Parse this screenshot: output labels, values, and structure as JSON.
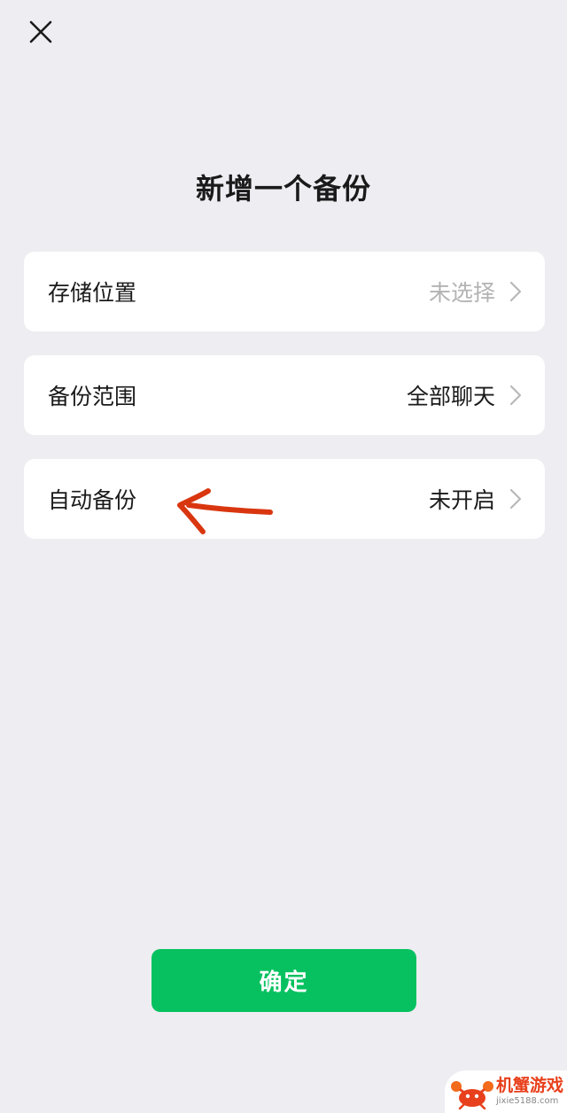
{
  "header": {
    "title": "新增一个备份"
  },
  "settings": {
    "items": [
      {
        "label": "存储位置",
        "value": "未选择"
      },
      {
        "label": "备份范围",
        "value": "全部聊天"
      },
      {
        "label": "自动备份",
        "value": "未开启"
      }
    ]
  },
  "footer": {
    "confirm_label": "确定"
  },
  "watermark": {
    "name": "机蟹游戏",
    "url": "jixie5188.com"
  },
  "colors": {
    "background": "#eeedf2",
    "card": "#ffffff",
    "primary_green": "#07c160",
    "muted_text": "#b3b3b3",
    "annotation_arrow": "#d9360f"
  },
  "icons": {
    "close": "close-icon",
    "chevron": "chevron-right-icon",
    "annotation": "red-arrow-annotation"
  }
}
